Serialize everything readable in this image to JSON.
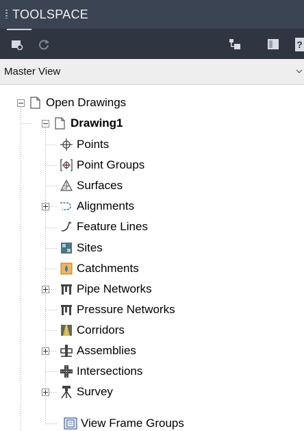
{
  "panel": {
    "title": "TOOLSPACE"
  },
  "toolbar": {
    "icons": [
      "prospector-icon",
      "refresh-icon",
      "item-view-icon",
      "toggle-panel-icon",
      "help-icon"
    ]
  },
  "view_selector": {
    "selected": "Master View"
  },
  "tree": {
    "root": "Open Drawings",
    "drawing": "Drawing1",
    "items": {
      "points": "Points",
      "point_groups": "Point Groups",
      "surfaces": "Surfaces",
      "alignments": "Alignments",
      "feature_lines": "Feature Lines",
      "sites": "Sites",
      "catchments": "Catchments",
      "pipe_networks": "Pipe Networks",
      "pressure_networks": "Pressure Networks",
      "corridors": "Corridors",
      "assemblies": "Assemblies",
      "intersections": "Intersections",
      "survey": "Survey",
      "view_frame_groups": "View Frame Groups"
    }
  },
  "colors": {
    "title_bar": "#3b4453",
    "toolbar": "#2f3642",
    "view_bar": "#eeeeee"
  }
}
